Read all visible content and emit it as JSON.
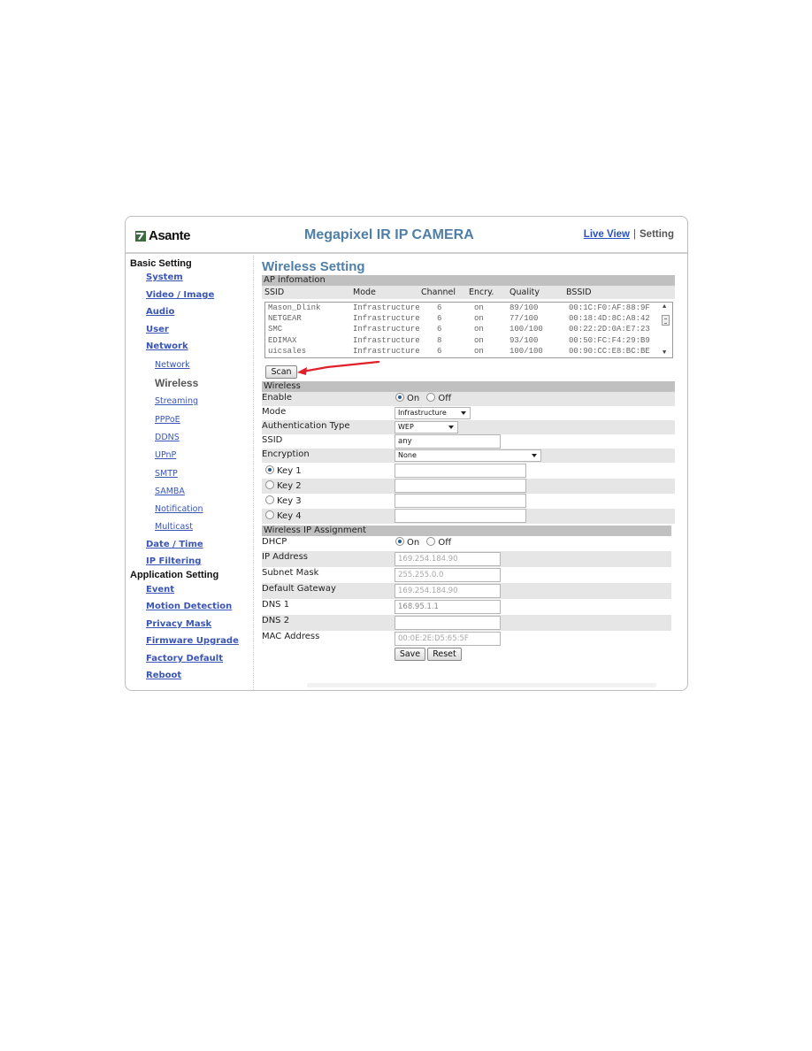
{
  "header": {
    "logo_text": "Asante",
    "app_title": "Megapixel IR IP CAMERA",
    "live_view_link": "Live View",
    "separator": "|",
    "setting_label": "Setting"
  },
  "sidebar": {
    "basic_heading": "Basic Setting",
    "basic_items": [
      {
        "label": "System"
      },
      {
        "label": "Video / Image"
      },
      {
        "label": "Audio"
      },
      {
        "label": "User"
      },
      {
        "label": "Network"
      }
    ],
    "network_sub_items": [
      {
        "label": "Network"
      },
      {
        "label": "Wireless",
        "current": true
      },
      {
        "label": "Streaming"
      },
      {
        "label": "PPPoE"
      },
      {
        "label": "DDNS"
      },
      {
        "label": "UPnP"
      },
      {
        "label": "SMTP"
      },
      {
        "label": "SAMBA"
      },
      {
        "label": "Notification"
      },
      {
        "label": "Multicast"
      }
    ],
    "more_basic_items": [
      {
        "label": "Date / Time"
      },
      {
        "label": "IP Filtering"
      }
    ],
    "application_heading": "Application Setting",
    "application_items": [
      {
        "label": "Event"
      },
      {
        "label": "Motion Detection"
      },
      {
        "label": "Privacy Mask"
      },
      {
        "label": "Firmware Upgrade"
      },
      {
        "label": "Factory Default"
      },
      {
        "label": "Reboot"
      }
    ]
  },
  "main": {
    "page_title": "Wireless Setting",
    "ap_section": {
      "title": "AP infomation",
      "columns": [
        "SSID",
        "Mode",
        "Channel",
        "Encry.",
        "Quality",
        "BSSID"
      ],
      "rows": [
        [
          "Mason_Dlink",
          "Infrastructure",
          "6",
          "on",
          "89/100",
          "00:1C:F0:AF:88:9F"
        ],
        [
          "NETGEAR",
          "Infrastructure",
          "6",
          "on",
          "77/100",
          "00:18:4D:8C:A8:42"
        ],
        [
          "SMC",
          "Infrastructure",
          "6",
          "on",
          "100/100",
          "00:22:2D:0A:E7:23"
        ],
        [
          "EDIMAX",
          "Infrastructure",
          "8",
          "on",
          "93/100",
          "00:50:FC:F4:29:B9"
        ],
        [
          "uicsales",
          "Infrastructure",
          "6",
          "on",
          "100/100",
          "00:90:CC:E8:BC:BE"
        ]
      ],
      "scan_button": "Scan"
    },
    "wireless_section": {
      "title": "Wireless",
      "enable_label": "Enable",
      "enable_on": "On",
      "enable_off": "Off",
      "enable_value": "On",
      "mode_label": "Mode",
      "mode_value": "Infrastructure",
      "auth_label": "Authentication Type",
      "auth_value": "WEP",
      "ssid_label": "SSID",
      "ssid_value": "any",
      "encryption_label": "Encryption",
      "encryption_value": "None",
      "keys": [
        {
          "label": "Key 1",
          "selected": true,
          "value": ""
        },
        {
          "label": "Key 2",
          "selected": false,
          "value": ""
        },
        {
          "label": "Key 3",
          "selected": false,
          "value": ""
        },
        {
          "label": "Key 4",
          "selected": false,
          "value": ""
        }
      ]
    },
    "ip_section": {
      "title": "Wireless IP Assignment",
      "dhcp_label": "DHCP",
      "dhcp_on": "On",
      "dhcp_off": "Off",
      "dhcp_value": "On",
      "ip_label": "IP Address",
      "ip_value": "169.254.184.90",
      "subnet_label": "Subnet Mask",
      "subnet_value": "255.255.0.0",
      "gateway_label": "Default Gateway",
      "gateway_value": "169.254.184.90",
      "dns1_label": "DNS 1",
      "dns1_value": "168.95.1.1",
      "dns2_label": "DNS 2",
      "dns2_value": "",
      "mac_label": "MAC Address",
      "mac_value": "00:0E:2E:D5:65:5F",
      "save_button": "Save",
      "reset_button": "Reset"
    }
  },
  "colors": {
    "title_blue": "#4f7fa6",
    "link_blue": "#3a55b4",
    "section_bar": "#c0c0c0",
    "alt_row": "#e6e6e6",
    "annotation_arrow": "#e0202a"
  }
}
